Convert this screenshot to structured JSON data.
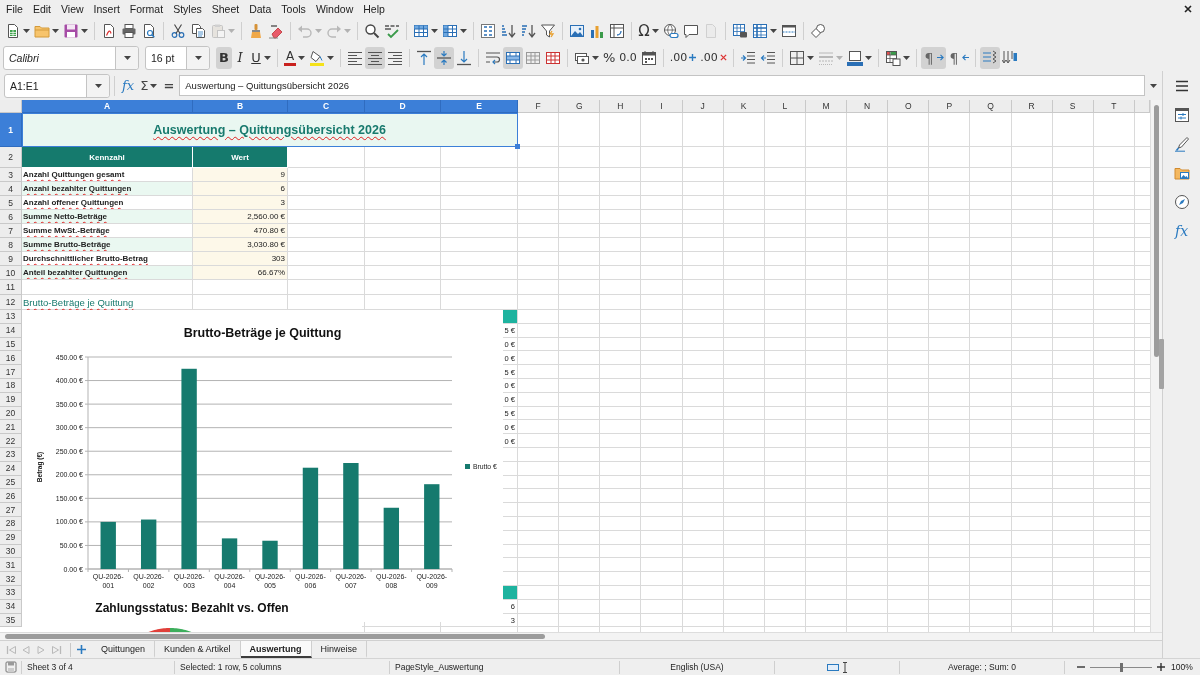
{
  "menu_bar": [
    "File",
    "Edit",
    "View",
    "Insert",
    "Format",
    "Styles",
    "Sheet",
    "Data",
    "Tools",
    "Window",
    "Help"
  ],
  "standard_toolbar": {
    "groups": [
      [
        {
          "kind": "new",
          "disabled": false
        },
        {
          "kind": "open",
          "disabled": false
        },
        {
          "kind": "save",
          "disabled": false
        }
      ],
      [
        {
          "kind": "export_pdf",
          "disabled": false
        },
        {
          "kind": "print",
          "disabled": false
        },
        {
          "kind": "print_preview",
          "disabled": false
        }
      ],
      [
        {
          "kind": "cut",
          "disabled": false
        },
        {
          "kind": "copy",
          "disabled": false
        },
        {
          "kind": "paste",
          "disabled": true
        }
      ],
      [
        {
          "kind": "clone_formatting",
          "disabled": false
        },
        {
          "kind": "clear_formatting",
          "disabled": false
        }
      ],
      [
        {
          "kind": "undo",
          "disabled": true
        },
        {
          "kind": "redo",
          "disabled": true
        }
      ],
      [
        {
          "kind": "find_replace",
          "disabled": false
        },
        {
          "kind": "spelling",
          "disabled": false
        }
      ],
      [
        {
          "kind": "row",
          "disabled": false
        },
        {
          "kind": "column",
          "disabled": false
        }
      ],
      [
        {
          "kind": "sort",
          "disabled": false
        },
        {
          "kind": "sort_ascending",
          "disabled": false
        },
        {
          "kind": "sort_descending",
          "disabled": false
        },
        {
          "kind": "autofilter",
          "disabled": false
        }
      ],
      [
        {
          "kind": "image",
          "disabled": false
        },
        {
          "kind": "chart",
          "disabled": false
        },
        {
          "kind": "pivot_table",
          "disabled": false
        }
      ],
      [
        {
          "kind": "special_character",
          "label": "Ω",
          "disabled": false
        },
        {
          "kind": "hyperlink",
          "disabled": false
        },
        {
          "kind": "comment",
          "disabled": false
        },
        {
          "kind": "header_footer",
          "disabled": true
        }
      ],
      [
        {
          "kind": "print_area",
          "disabled": false
        },
        {
          "kind": "freeze",
          "disabled": false
        },
        {
          "kind": "split_window",
          "disabled": false
        }
      ],
      [
        {
          "kind": "draw_functions",
          "disabled": false
        }
      ]
    ]
  },
  "formatting_toolbar": {
    "font_name": "Calibri",
    "font_size": "16 pt",
    "groups": [
      [
        {
          "kind": "bold",
          "label": "B",
          "pressed": true,
          "disabled": false
        },
        {
          "kind": "italic",
          "label": "I",
          "pressed": false,
          "disabled": false
        },
        {
          "kind": "underline",
          "label": "U",
          "pressed": false,
          "disabled": false
        }
      ],
      [
        {
          "kind": "font_color",
          "label": "A",
          "pressed": false,
          "disabled": false
        },
        {
          "kind": "highlight",
          "pressed": false,
          "disabled": false
        }
      ],
      [
        {
          "kind": "align_left",
          "pressed": false,
          "disabled": false
        },
        {
          "kind": "align_center",
          "pressed": true,
          "disabled": false
        },
        {
          "kind": "align_right",
          "pressed": false,
          "disabled": false
        }
      ],
      [
        {
          "kind": "align_top",
          "pressed": false,
          "disabled": false
        },
        {
          "kind": "align_middle",
          "pressed": true,
          "disabled": false
        },
        {
          "kind": "align_bottom",
          "pressed": false,
          "disabled": false
        }
      ],
      [
        {
          "kind": "wrap_text",
          "pressed": false,
          "disabled": false
        },
        {
          "kind": "merge_center",
          "pressed": true,
          "disabled": false
        },
        {
          "kind": "merge",
          "pressed": false,
          "disabled": false
        },
        {
          "kind": "unmerge",
          "pressed": false,
          "disabled": false
        }
      ],
      [
        {
          "kind": "currency",
          "pressed": false,
          "disabled": false
        },
        {
          "kind": "percent",
          "label": "%",
          "pressed": false,
          "disabled": false
        },
        {
          "kind": "number",
          "label": "0.0",
          "pressed": false,
          "disabled": false
        },
        {
          "kind": "date",
          "pressed": false,
          "disabled": false
        }
      ],
      [
        {
          "kind": "add_decimal",
          "label": ".00",
          "pressed": false,
          "disabled": false
        },
        {
          "kind": "delete_decimal",
          "label": ".00",
          "pressed": false,
          "disabled": false
        }
      ],
      [
        {
          "kind": "indent_increase",
          "pressed": false,
          "disabled": false
        },
        {
          "kind": "indent_decrease",
          "pressed": false,
          "disabled": false
        }
      ],
      [
        {
          "kind": "borders",
          "pressed": false,
          "disabled": false
        },
        {
          "kind": "border_style",
          "pressed": false,
          "disabled": true
        },
        {
          "kind": "border_color",
          "pressed": false,
          "disabled": false
        }
      ],
      [
        {
          "kind": "conditional",
          "pressed": false,
          "disabled": false
        }
      ],
      [
        {
          "kind": "ltr",
          "label": "¶",
          "pressed": true,
          "disabled": false
        },
        {
          "kind": "rtl",
          "label": "¶",
          "pressed": false,
          "disabled": false
        }
      ],
      [
        {
          "kind": "text_direction",
          "pressed": true,
          "disabled": false
        },
        {
          "kind": "vertical_text",
          "pressed": false,
          "disabled": false
        }
      ]
    ]
  },
  "formula_bar": {
    "name_box": "A1:E1",
    "function_wizard": "fx",
    "sum": "Σ",
    "formula_sign": "=",
    "formula": "Auswertung – Quittungsübersicht 2026"
  },
  "sheet": {
    "column_headers": [
      {
        "label": "A",
        "selected": true
      },
      {
        "label": "B",
        "selected": true
      },
      {
        "label": "C",
        "selected": true
      },
      {
        "label": "D",
        "selected": true
      },
      {
        "label": "E",
        "selected": true
      },
      {
        "label": "F",
        "selected": false
      },
      {
        "label": "G",
        "selected": false
      },
      {
        "label": "H",
        "selected": false
      },
      {
        "label": "I",
        "selected": false
      },
      {
        "label": "J",
        "selected": false
      },
      {
        "label": "K",
        "selected": false
      },
      {
        "label": "L",
        "selected": false
      },
      {
        "label": "M",
        "selected": false
      },
      {
        "label": "N",
        "selected": false
      },
      {
        "label": "O",
        "selected": false
      },
      {
        "label": "P",
        "selected": false
      },
      {
        "label": "Q",
        "selected": false
      },
      {
        "label": "R",
        "selected": false
      },
      {
        "label": "S",
        "selected": false
      },
      {
        "label": "T",
        "selected": false
      }
    ],
    "row_headers": [
      {
        "label": "1",
        "selected": true
      },
      {
        "label": "2",
        "selected": false
      },
      {
        "label": "3",
        "selected": false
      },
      {
        "label": "4",
        "selected": false
      },
      {
        "label": "5",
        "selected": false
      },
      {
        "label": "6",
        "selected": false
      },
      {
        "label": "7",
        "selected": false
      },
      {
        "label": "8",
        "selected": false
      },
      {
        "label": "9",
        "selected": false
      },
      {
        "label": "10",
        "selected": false
      },
      {
        "label": "11",
        "selected": false
      },
      {
        "label": "12",
        "selected": false
      },
      {
        "label": "13",
        "selected": false
      },
      {
        "label": "14",
        "selected": false
      },
      {
        "label": "15",
        "selected": false
      },
      {
        "label": "16",
        "selected": false
      },
      {
        "label": "17",
        "selected": false
      },
      {
        "label": "18",
        "selected": false
      },
      {
        "label": "19",
        "selected": false
      },
      {
        "label": "20",
        "selected": false
      },
      {
        "label": "21",
        "selected": false
      },
      {
        "label": "22",
        "selected": false
      },
      {
        "label": "23",
        "selected": false
      },
      {
        "label": "24",
        "selected": false
      },
      {
        "label": "25",
        "selected": false
      },
      {
        "label": "26",
        "selected": false
      },
      {
        "label": "27",
        "selected": false
      },
      {
        "label": "28",
        "selected": false
      },
      {
        "label": "29",
        "selected": false
      },
      {
        "label": "30",
        "selected": false
      },
      {
        "label": "31",
        "selected": false
      },
      {
        "label": "32",
        "selected": false
      },
      {
        "label": "33",
        "selected": false
      },
      {
        "label": "34",
        "selected": false
      },
      {
        "label": "35",
        "selected": false
      }
    ],
    "title": "Auswertung – Quittungsübersicht 2026",
    "summary_table": {
      "columns": [
        "Kennzahl",
        "Wert"
      ],
      "rows": [
        {
          "label": "Anzahl Quittungen gesamt",
          "value": "9"
        },
        {
          "label": "Anzahl bezahlter Quittungen",
          "value": "6"
        },
        {
          "label": "Anzahl offener Quittungen",
          "value": "3"
        },
        {
          "label": "Summe Netto-Beträge",
          "value": "2,560.00 €"
        },
        {
          "label": "Summe MwSt.-Beträge",
          "value": "470.80 €"
        },
        {
          "label": "Summe Brutto-Beträge",
          "value": "3,030.80 €"
        },
        {
          "label": "Durchschnittlicher Brutto-Betrag",
          "value": "303"
        },
        {
          "label": "Anteil bezahlter Quittungen",
          "value": "66.67%"
        }
      ]
    },
    "section_heading": "Brutto-Beträge je Quittung",
    "column_e_fragments": [
      "5 €",
      "0 €",
      "0 €",
      "5 €",
      "0 €",
      "0 €",
      "5 €",
      "0 €",
      "0 €"
    ],
    "column_e_fragments_lower": [
      "6",
      "3"
    ],
    "charts": [
      {
        "chart_data": {
          "type": "bar",
          "title": "Brutto-Beträge je Quittung",
          "ylabel": "Betrag (€)",
          "categories": [
            "QU-2026-001",
            "QU-2026-002",
            "QU-2026-003",
            "QU-2026-004",
            "QU-2026-005",
            "QU-2026-006",
            "QU-2026-007",
            "QU-2026-008",
            "QU-2026-009"
          ],
          "series": [
            {
              "name": "Brutto €",
              "color": "#167a6e",
              "values": [
                100,
                105,
                425,
                65,
                60,
                215,
                225,
                130,
                180
              ]
            }
          ],
          "ylim": [
            0,
            450
          ],
          "yticks": [
            {
              "value": 0,
              "label": "0.00 €"
            },
            {
              "value": 50,
              "label": "50.00 €"
            },
            {
              "value": 100,
              "label": "100.00 €"
            },
            {
              "value": 150,
              "label": "150.00 €"
            },
            {
              "value": 200,
              "label": "200.00 €"
            },
            {
              "value": 250,
              "label": "250.00 €"
            },
            {
              "value": 300,
              "label": "300.00 €"
            },
            {
              "value": 350,
              "label": "350.00 €"
            },
            {
              "value": 400,
              "label": "400.00 €"
            },
            {
              "value": 450,
              "label": "450.00 €"
            }
          ],
          "grid": true
        }
      }
    ],
    "status_chart": {
      "title": "Zahlungsstatus: Bezahlt vs. Offen"
    }
  },
  "sidebar": {
    "functions": "fx"
  },
  "sheet_tabs": {
    "nav_buttons": [
      {
        "kind": "first",
        "disabled": true
      },
      {
        "kind": "previous",
        "disabled": true
      },
      {
        "kind": "next",
        "disabled": true
      },
      {
        "kind": "last",
        "disabled": true
      }
    ],
    "tabs": [
      {
        "label": "Quittungen",
        "selected": false
      },
      {
        "label": "Kunden & Artikel",
        "selected": false
      },
      {
        "label": "Auswertung",
        "selected": true
      },
      {
        "label": "Hinweise",
        "selected": false
      }
    ]
  },
  "status_bar": {
    "sheet_position": "Sheet 3 of 4",
    "selection": "Selected: 1 row, 5 columns",
    "page_style": "PageStyle_Auswertung",
    "language": "English (USA)",
    "summary": "Average: ; Sum: 0",
    "zoom": {
      "level": 0.5,
      "percent": "100%"
    }
  }
}
